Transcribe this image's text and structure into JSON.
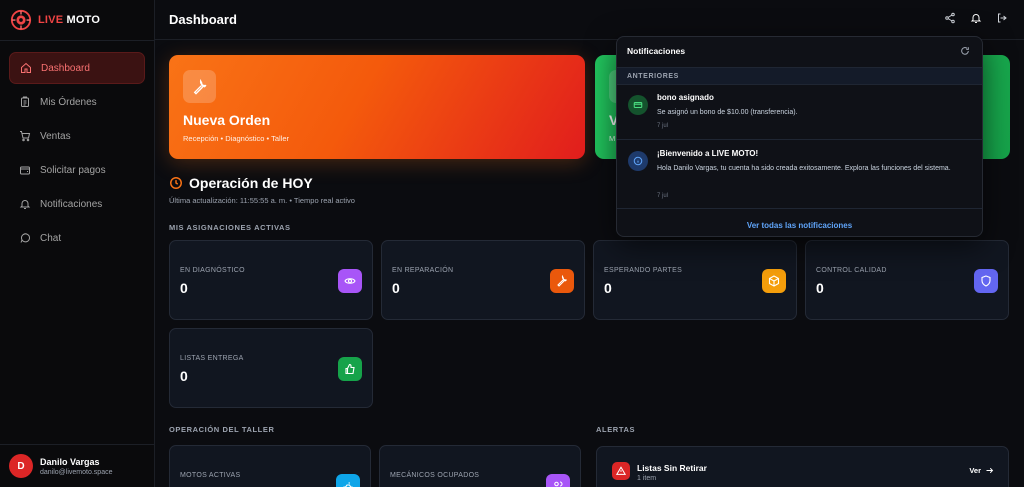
{
  "brand": {
    "live": "LIVE",
    "moto": "MOTO"
  },
  "sidebar": {
    "items": [
      {
        "label": "Dashboard",
        "icon": "home-icon",
        "active": true
      },
      {
        "label": "Mis Órdenes",
        "icon": "clipboard-icon"
      },
      {
        "label": "Ventas",
        "icon": "cart-icon"
      },
      {
        "label": "Solicitar pagos",
        "icon": "wallet-icon"
      },
      {
        "label": "Notificaciones",
        "icon": "bell-icon"
      },
      {
        "label": "Chat",
        "icon": "chat-icon"
      }
    ]
  },
  "user": {
    "initial": "D",
    "name": "Danilo Vargas",
    "email": "danilo@livemoto.space"
  },
  "header": {
    "title": "Dashboard",
    "icons": [
      "share-icon",
      "bell-icon",
      "logout-icon"
    ]
  },
  "banners": {
    "orange": {
      "title": "Nueva Orden",
      "subtitle": "Recepción • Diagnóstico • Taller"
    },
    "green": {
      "title_partial": "V",
      "subtitle_partial": "M"
    }
  },
  "operation": {
    "title": "Operación de HOY",
    "subtitle": "Última actualización: 11:55:55 a. m. • Tiempo real activo"
  },
  "assignments": {
    "label": "MIS ASIGNACIONES ACTIVAS",
    "cards": [
      {
        "label": "EN DIAGNÓSTICO",
        "value": "0",
        "icon": "eye-icon",
        "color": "#a855f7"
      },
      {
        "label": "EN REPARACIÓN",
        "value": "0",
        "icon": "wrench-icon",
        "color": "#ea580c"
      },
      {
        "label": "ESPERANDO PARTES",
        "value": "0",
        "icon": "package-icon",
        "color": "#f59e0b"
      },
      {
        "label": "CONTROL CALIDAD",
        "value": "0",
        "icon": "shield-icon",
        "color": "#6366f1"
      },
      {
        "label": "LISTAS ENTREGA",
        "value": "0",
        "icon": "thumbs-up-icon",
        "color": "#16a34a"
      }
    ]
  },
  "taller": {
    "label": "OPERACIÓN DEL TALLER",
    "cards": [
      {
        "label": "MOTOS ACTIVAS",
        "icon": "motorcycle-icon",
        "color": "#0ea5e9"
      },
      {
        "label": "MECÁNICOS OCUPADOS",
        "icon": "users-icon",
        "color": "#a855f7"
      }
    ]
  },
  "alerts": {
    "label": "ALERTAS",
    "items": [
      {
        "title": "Listas Sin Retirar",
        "subtitle": "1 item",
        "link": "Ver",
        "icon": "warning-icon",
        "color": "#dc2626"
      }
    ]
  },
  "notifications": {
    "title": "Notificaciones",
    "group": "ANTERIORES",
    "items": [
      {
        "title": "bono asignado",
        "body": "Se asignó un bono de $10.00 (transferencia).",
        "time": "7 jul",
        "icon": "card-icon",
        "color": "#22c55e"
      },
      {
        "title": "¡Bienvenido a LIVE MOTO!",
        "body": "Hola Danilo Vargas, tu cuenta ha sido creada exitosamente. Explora las funciones del sistema.",
        "time": "7 jul",
        "icon": "info-icon",
        "color": "#3b82f6"
      }
    ],
    "footer": "Ver todas las notificaciones"
  }
}
